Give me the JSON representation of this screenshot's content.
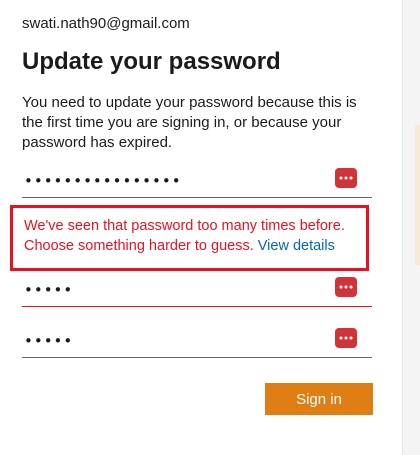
{
  "account": {
    "email": "swati.nath90@gmail.com"
  },
  "page": {
    "title": "Update your password",
    "description": "You need to update your password because this is the first time you are signing in, or because your password has expired."
  },
  "fields": {
    "current_password": {
      "masked_value": "••••••••••••••••"
    },
    "new_password": {
      "masked_value": "•••••"
    },
    "confirm_password": {
      "masked_value": "•••••"
    }
  },
  "error": {
    "message": "We've seen that password too many times before. Choose something harder to guess.",
    "link_label": "View details"
  },
  "actions": {
    "signin_label": "Sign in"
  },
  "colors": {
    "error": "#e81123",
    "link": "#0067b8",
    "primary_button": "#df7e13",
    "reveal_icon_bg": "#d13438"
  },
  "icons": {
    "reveal": "password-reveal-icon"
  }
}
